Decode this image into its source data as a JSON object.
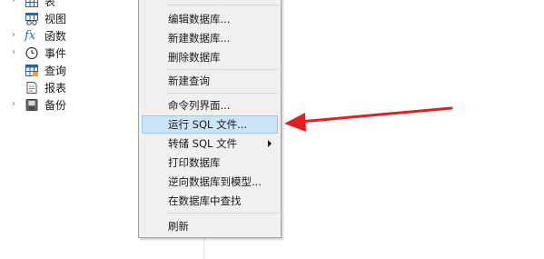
{
  "tree": {
    "items": [
      {
        "label": "表",
        "has_chevron": true,
        "icon": "table-icon"
      },
      {
        "label": "视图",
        "has_chevron": false,
        "icon": "view-icon"
      },
      {
        "label": "函数",
        "has_chevron": true,
        "icon": "function-icon"
      },
      {
        "label": "事件",
        "has_chevron": true,
        "icon": "event-clock-icon"
      },
      {
        "label": "查询",
        "has_chevron": false,
        "icon": "query-icon"
      },
      {
        "label": "报表",
        "has_chevron": false,
        "icon": "report-icon"
      },
      {
        "label": "备份",
        "has_chevron": true,
        "icon": "backup-icon"
      }
    ],
    "fx_glyph": "fx"
  },
  "context_menu": {
    "items": [
      {
        "label": "编辑数据库...",
        "highlighted": false
      },
      {
        "label": "新建数据库...",
        "highlighted": false
      },
      {
        "label": "删除数据库",
        "highlighted": false
      },
      {
        "label": "新建查询",
        "highlighted": false
      },
      {
        "label": "命令列界面...",
        "highlighted": false
      },
      {
        "label": "运行 SQL 文件...",
        "highlighted": true
      },
      {
        "label": "转储 SQL 文件",
        "highlighted": false,
        "has_submenu": true
      },
      {
        "label": "打印数据库",
        "highlighted": false
      },
      {
        "label": "逆向数据库到模型...",
        "highlighted": false
      },
      {
        "label": "在数据库中查找",
        "highlighted": false
      },
      {
        "label": "刷新",
        "highlighted": false
      }
    ]
  },
  "annotation": {
    "type": "arrow",
    "color": "#e02020",
    "points_to": "运行 SQL 文件..."
  },
  "colors": {
    "menu_bg": "#f0f0f0",
    "menu_border": "#a0a0a0",
    "highlight_bg": "#cce4f7",
    "highlight_border": "#99c9ef",
    "arrow": "#e02020",
    "icon_blue": "#2b5fa8"
  }
}
